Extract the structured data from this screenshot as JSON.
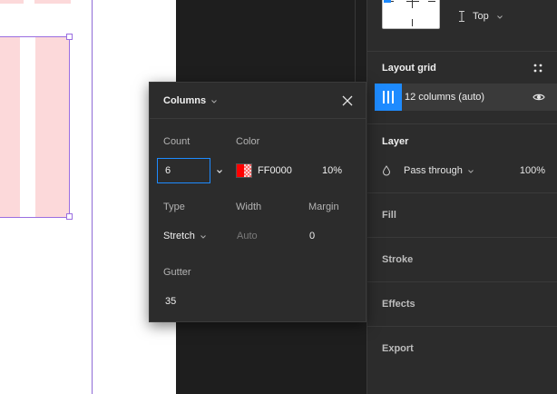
{
  "popover": {
    "title": "Columns",
    "count_label": "Count",
    "count_value": "6",
    "color_label": "Color",
    "color_hex": "FF0000",
    "color_opacity": "10%",
    "type_label": "Type",
    "type_value": "Stretch",
    "width_label": "Width",
    "width_value": "Auto",
    "margin_label": "Margin",
    "margin_value": "0",
    "gutter_label": "Gutter",
    "gutter_value": "35",
    "swatch_color": "#FF0000"
  },
  "panel": {
    "vertical_constraint": "Top",
    "layout_grid": {
      "title": "Layout grid",
      "item_label": "12 columns (auto)"
    },
    "layer": {
      "title": "Layer",
      "blend_mode": "Pass through",
      "opacity": "100%"
    },
    "sections": {
      "fill": "Fill",
      "stroke": "Stroke",
      "effects": "Effects",
      "export": "Export"
    }
  },
  "colors": {
    "accent": "#1E8BFF",
    "selection": "#9A6EE0",
    "grid_column": "#FCD9DA"
  }
}
